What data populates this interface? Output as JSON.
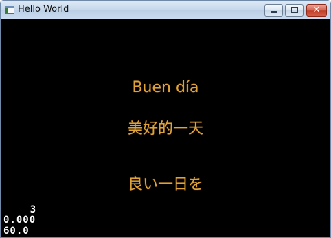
{
  "window": {
    "title": "Hello World",
    "close_glyph": "✕"
  },
  "canvas": {
    "greetings": [
      "Buen día",
      "美好的一天",
      "良い一日を"
    ],
    "stats": [
      "    3",
      "0.000",
      "60.0"
    ],
    "text_color": "#e0a339",
    "background": "#000000"
  },
  "icons": {
    "app": "window-app-icon",
    "minimize": "minimize-icon",
    "maximize": "maximize-icon",
    "close": "close-icon"
  }
}
